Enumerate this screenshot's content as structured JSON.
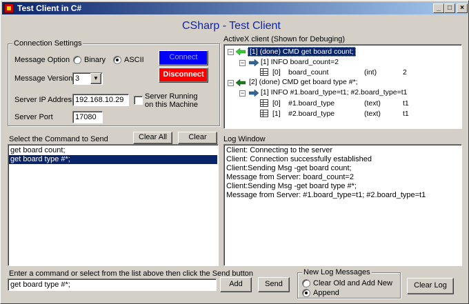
{
  "window": {
    "title": "Test Client in C#"
  },
  "caption_buttons": {
    "minimize": "_",
    "maximize": "□",
    "close": "×"
  },
  "header": {
    "title": "CSharp - Test Client"
  },
  "connection": {
    "group_title": "Connection Settings",
    "message_option_label": "Message Option",
    "binary_label": "Binary",
    "ascii_label": "ASCII",
    "selected_option": "ASCII",
    "message_version_label": "Message Version",
    "message_version_value": "3",
    "server_ip_label": "Server IP Address",
    "server_ip_value": "192.168.10.29",
    "server_port_label": "Server Port",
    "server_port_value": "17080",
    "local_server_label_line1": "Server Running",
    "local_server_label_line2": "on this Machine",
    "local_server_checked": false,
    "connect_label": "Connect",
    "disconnect_label": "Disconnect",
    "connect_color": "#0000ff",
    "disconnect_color": "#ff0000"
  },
  "activex": {
    "title": "ActiveX client (Shown for Debuging)",
    "nodes": [
      {
        "col1": "[1]  (done)    CMD       get board count;",
        "selected": true
      },
      {
        "col1": "[1]  INFO       board_count=2"
      },
      {
        "idx": "[0]",
        "name": "board_count",
        "type": "(int)",
        "value": "2"
      },
      {
        "col1": "[2]  (done)    CMD       get board type #*;"
      },
      {
        "col1": "[1]  INFO       #1.board_type=t1; #2.board_type=t1"
      },
      {
        "idx": "[0]",
        "name": "#1.board_type",
        "type": "(text)",
        "value": "t1"
      },
      {
        "idx": "[1]",
        "name": "#2.board_type",
        "type": "(text)",
        "value": "t1"
      }
    ]
  },
  "commands": {
    "label": "Select the Command to Send",
    "clear_all_label": "Clear All",
    "clear_label": "Clear",
    "items": [
      "get board count;",
      "get board type #*;"
    ],
    "selected_index": 1
  },
  "log": {
    "label": "Log Window",
    "lines": [
      "Client: Connecting to the server",
      "Client: Connection successfully established",
      "Client:Sending Msg -get board count;",
      "Message from Server: board_count=2",
      "Client:Sending Msg -get board type #*;",
      "Message from Server: #1.board_type=t1; #2.board_type=t1"
    ]
  },
  "entry": {
    "label": "Enter a command or select from the list above then click the Send button",
    "value": "get board type #*;",
    "add_label": "Add",
    "send_label": "Send"
  },
  "new_log": {
    "group_title": "New Log Messages",
    "clear_old_label": "Clear Old and Add New",
    "append_label": "Append",
    "selected": "Append",
    "clear_log_label": "Clear Log"
  }
}
